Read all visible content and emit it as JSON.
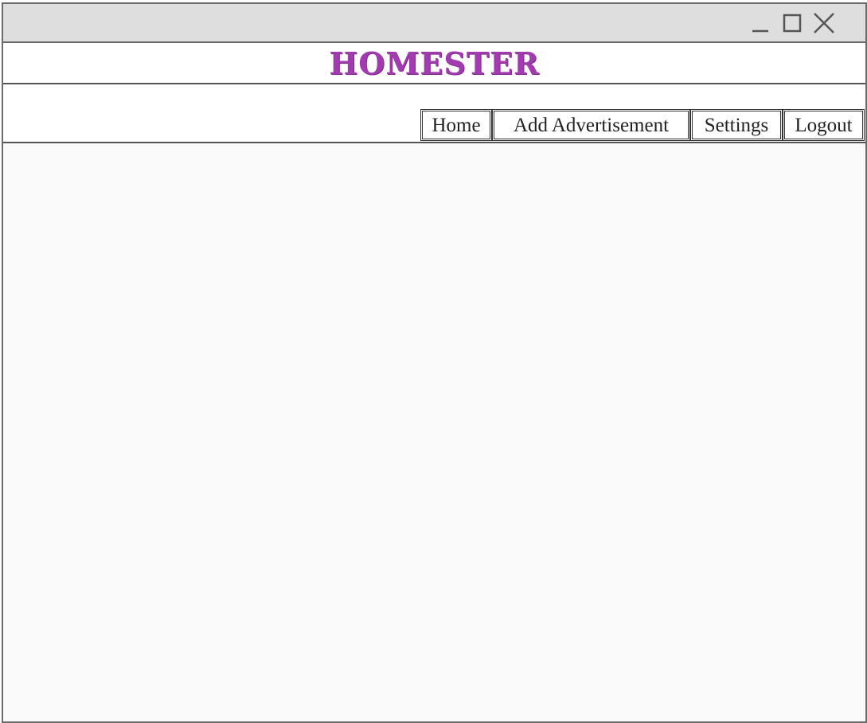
{
  "window": {
    "controls": {
      "minimize_icon": "minimize-icon",
      "maximize_icon": "maximize-icon",
      "close_icon": "close-icon"
    }
  },
  "header": {
    "brand": "HOMESTER"
  },
  "nav": {
    "items": [
      {
        "label": "Home"
      },
      {
        "label": "Add Advertisement"
      },
      {
        "label": "Settings"
      },
      {
        "label": "Logout"
      }
    ]
  },
  "colors": {
    "brand": "#a23bb0",
    "titlebar": "#dedede",
    "border": "#6b6b6b",
    "content_bg": "#fafafa"
  }
}
